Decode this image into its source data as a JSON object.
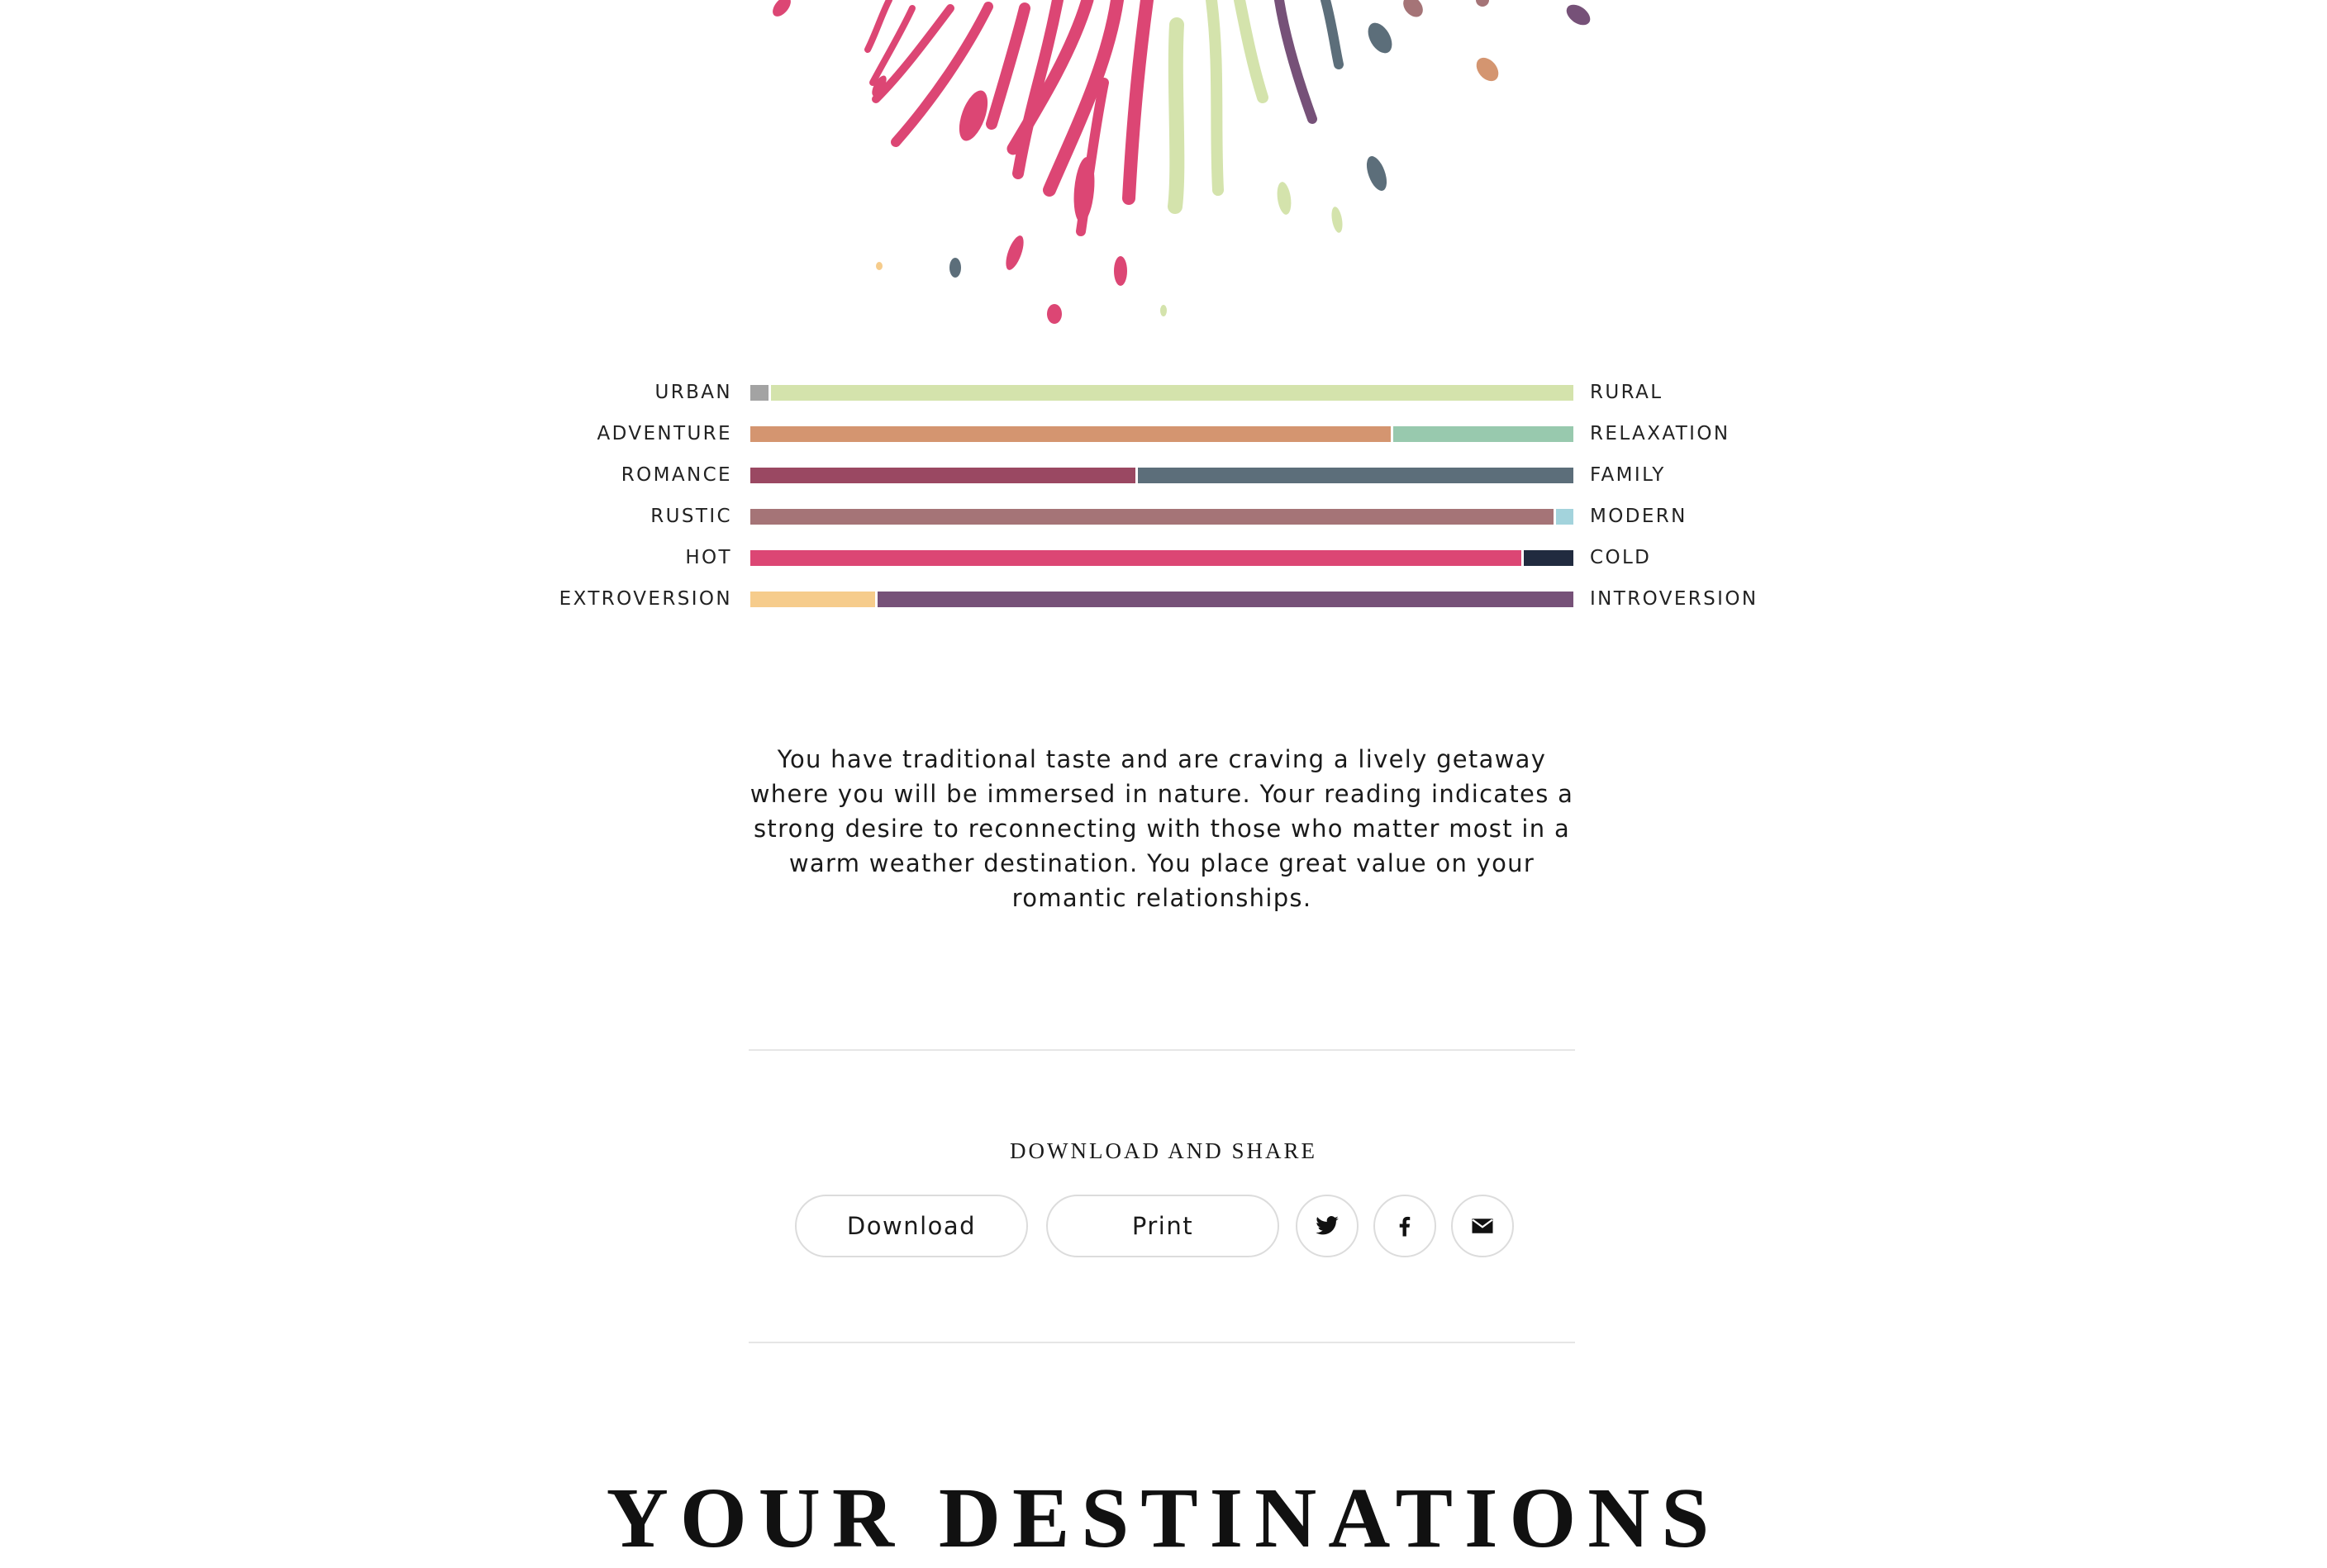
{
  "scales": [
    {
      "left": "URBAN",
      "right": "RURAL",
      "left_share": 0.022,
      "left_color": "#a3a3a3",
      "right_color": "#d4e3ac"
    },
    {
      "left": "ADVENTURE",
      "right": "RELAXATION",
      "left_share": 0.778,
      "left_color": "#d49570",
      "right_color": "#98c9ae"
    },
    {
      "left": "ROMANCE",
      "right": "FAMILY",
      "left_share": 0.468,
      "left_color": "#9a4862",
      "right_color": "#5c6e7a"
    },
    {
      "left": "RUSTIC",
      "right": "MODERN",
      "left_share": 0.976,
      "left_color": "#a57477",
      "right_color": "#a3d3dc"
    },
    {
      "left": "HOT",
      "right": "COLD",
      "left_share": 0.937,
      "left_color": "#dc4674",
      "right_color": "#212b3f"
    },
    {
      "left": "EXTROVERSION",
      "right": "INTROVERSION",
      "left_share": 0.152,
      "left_color": "#f6cc8c",
      "right_color": "#765178"
    }
  ],
  "summary": "You have traditional taste and are craving a lively getaway where you will be immersed in nature. Your reading indicates a strong desire to reconnecting with those who matter most in a warm weather destination. You place great value on your romantic relationships.",
  "share": {
    "title": "DOWNLOAD AND SHARE",
    "download_label": "Download",
    "print_label": "Print",
    "icons": [
      "twitter-icon",
      "facebook-icon",
      "email-icon"
    ]
  },
  "destinations_heading": "YOUR DESTINATIONS",
  "art_colors": [
    "#dc4674",
    "#d4e3ac",
    "#765178",
    "#5c6e7a",
    "#a57477",
    "#d49570",
    "#f6cc8c"
  ]
}
